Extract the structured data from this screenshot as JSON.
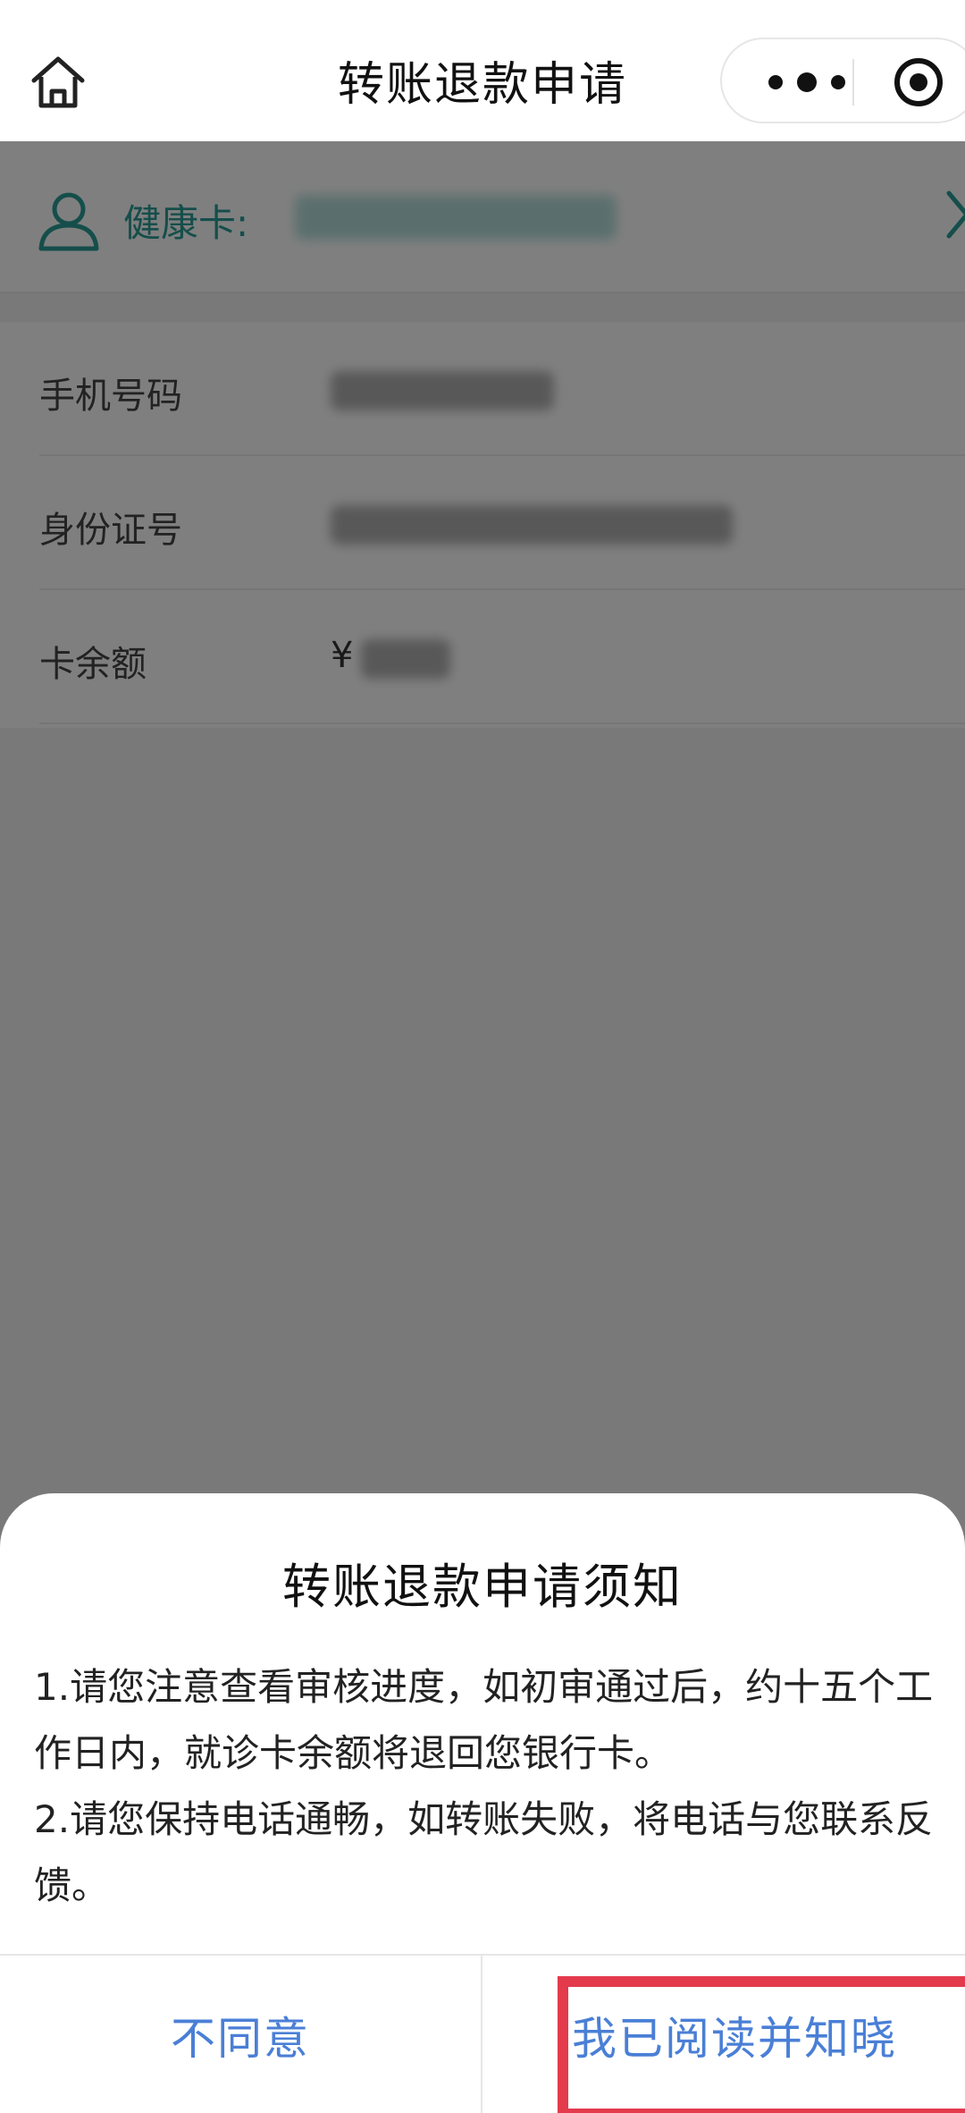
{
  "nav": {
    "title": "转账退款申请",
    "icons": [
      "home-icon",
      "more-icon",
      "close-mini-program-icon"
    ]
  },
  "card": {
    "label": "健康卡:",
    "value_redacted": true
  },
  "info": [
    {
      "label": "手机号码"
    },
    {
      "label": "身份证号"
    },
    {
      "label": "卡余额",
      "value_prefix": "¥"
    }
  ],
  "sheet": {
    "title": "转账退款申请须知",
    "lines": [
      "1.请您注意查看审核进度，如初审通过后，约十五个工作日内，就诊卡余额将退回您银行卡。",
      "2.请您保持电话通畅，如转账失败，将电话与您联系反馈。"
    ],
    "disagree_label": "不同意",
    "agree_label": "我已阅读并知晓"
  },
  "colors": {
    "accent": "#2a9d97",
    "button_text": "#4a7fd6",
    "highlight": "#e33a4c"
  }
}
